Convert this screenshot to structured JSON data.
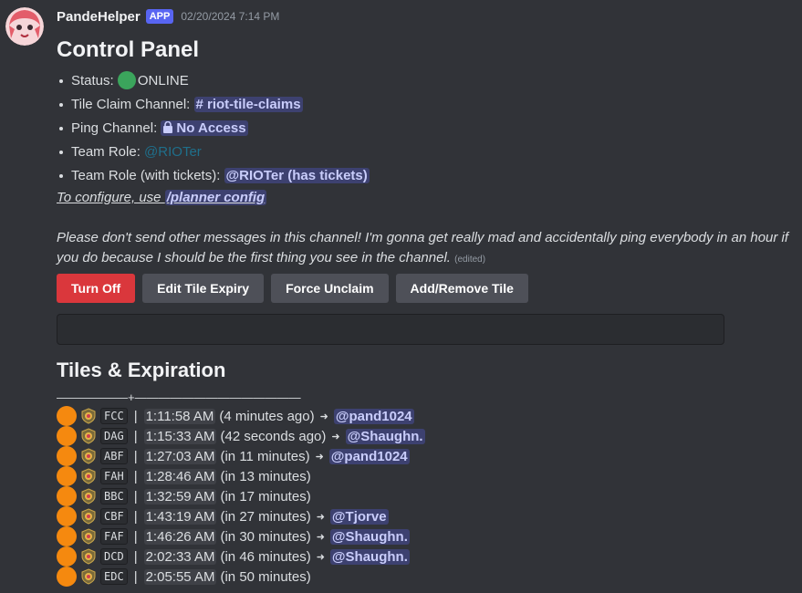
{
  "author": {
    "name": "PandeHelper",
    "tag": "APP",
    "timestamp": "02/20/2024 7:14 PM"
  },
  "panel": {
    "title": "Control Panel",
    "status_label": "Status:",
    "status_value": "ONLINE",
    "tile_claim_label": "Tile Claim Channel:",
    "tile_claim_value": "# riot-tile-claims",
    "ping_label": "Ping Channel:",
    "ping_value": "No Access",
    "team_role_label": "Team Role:",
    "team_role_value": "@RIOTer",
    "team_role_tickets_label": "Team Role (with tickets):",
    "team_role_tickets_value": "@RIOTer (has tickets)",
    "configure_text": "To configure, use",
    "configure_command": "/planner config",
    "note": "Please don't send other messages in this channel! I'm gonna get really mad and accidentally ping everybody in an hour if you do because I should be the first thing you see in the channel.",
    "edited": "(edited)"
  },
  "buttons": {
    "turn_off": "Turn Off",
    "edit_expiry": "Edit Tile Expiry",
    "force_unclaim": "Force Unclaim",
    "add_remove": "Add/Remove Tile"
  },
  "tiles": {
    "title": "Tiles & Expiration",
    "divider": "——————+——————————————",
    "rows": [
      {
        "code": "FCC",
        "time": "1:11:58 AM",
        "rel": "(4 minutes ago)",
        "user": "@pand1024"
      },
      {
        "code": "DAG",
        "time": "1:15:33 AM",
        "rel": "(42 seconds ago)",
        "user": "@Shaughn."
      },
      {
        "code": "ABF",
        "time": "1:27:03 AM",
        "rel": "(in 11 minutes)",
        "user": "@pand1024"
      },
      {
        "code": "FAH",
        "time": "1:28:46 AM",
        "rel": "(in 13 minutes)",
        "user": ""
      },
      {
        "code": "BBC",
        "time": "1:32:59 AM",
        "rel": "(in 17 minutes)",
        "user": ""
      },
      {
        "code": "CBF",
        "time": "1:43:19 AM",
        "rel": "(in 27 minutes)",
        "user": "@Tjorve"
      },
      {
        "code": "FAF",
        "time": "1:46:26 AM",
        "rel": "(in 30 minutes)",
        "user": "@Shaughn."
      },
      {
        "code": "DCD",
        "time": "2:02:33 AM",
        "rel": "(in 46 minutes)",
        "user": "@Shaughn."
      },
      {
        "code": "EDC",
        "time": "2:05:55 AM",
        "rel": "(in 50 minutes)",
        "user": ""
      }
    ]
  },
  "colors": {
    "background": "#313338",
    "danger": "#da373c",
    "secondary": "#4e5058",
    "online": "#3ba55c",
    "orange": "#f5890f",
    "mention_bg": "#4a4f8a"
  }
}
